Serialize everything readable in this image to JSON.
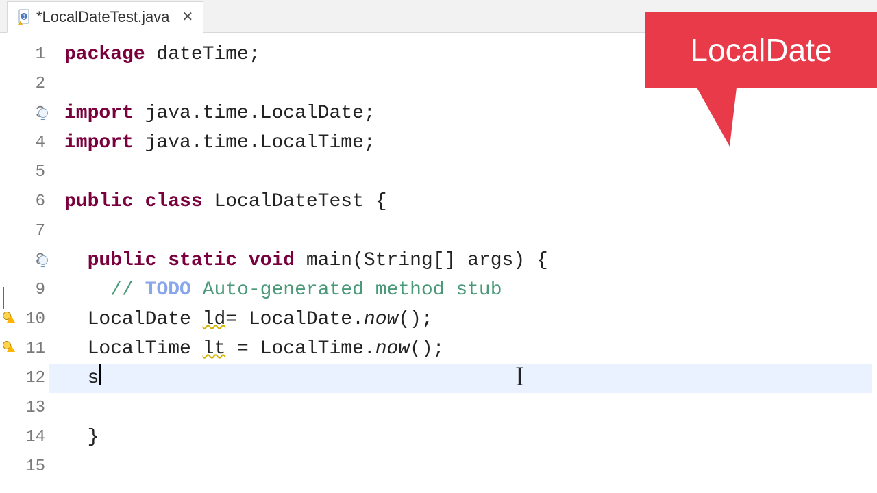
{
  "tab": {
    "title": "*LocalDateTest.java"
  },
  "callout": {
    "title": "LocalDate"
  },
  "code": {
    "package_kw": "package",
    "package_name": " dateTime;",
    "import_kw": "import",
    "import_1_rest": " java.time.LocalDate;",
    "import_2_rest": " java.time.LocalTime;",
    "public_kw": "public",
    "class_kw": " class ",
    "class_name": "LocalDateTest ",
    "open_brace": "{",
    "static_kw": " static ",
    "void_kw": "void",
    "main_sig": " main(String[] args) {",
    "todo_slashes": "// ",
    "todo_kw": "TODO",
    "todo_rest": " Auto-generated method stub",
    "line10_type": "LocalDate ",
    "line10_var": "ld",
    "line10_mid": "= LocalDate.",
    "line10_method": "now",
    "line10_end": "();",
    "line11_type": "LocalTime ",
    "line11_var": "lt",
    "line11_mid": " = LocalTime.",
    "line11_method": "now",
    "line11_end": "();",
    "line12_char": "s",
    "close_brace": "}"
  },
  "line_numbers": [
    "1",
    "2",
    "3",
    "4",
    "5",
    "6",
    "7",
    "8",
    "9",
    "10",
    "11",
    "12",
    "13",
    "14",
    "15"
  ]
}
